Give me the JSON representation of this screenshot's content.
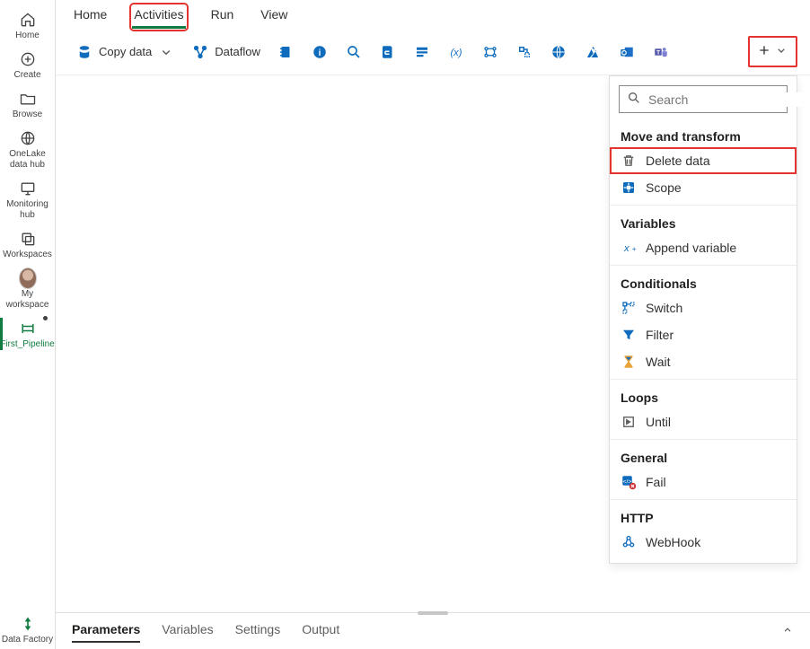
{
  "rail": {
    "items": [
      {
        "label": "Home"
      },
      {
        "label": "Create"
      },
      {
        "label": "Browse"
      },
      {
        "label": "OneLake data hub"
      },
      {
        "label": "Monitoring hub"
      },
      {
        "label": "Workspaces"
      },
      {
        "label": "My workspace"
      },
      {
        "label": "First_Pipeline"
      }
    ],
    "footer": "Data Factory"
  },
  "tabs": [
    "Home",
    "Activities",
    "Run",
    "View"
  ],
  "toolbar": {
    "copy_data": "Copy data",
    "dataflow": "Dataflow"
  },
  "panel": {
    "search_placeholder": "Search",
    "groups": [
      {
        "title": "Move and transform",
        "items": [
          "Delete data",
          "Scope"
        ]
      },
      {
        "title": "Variables",
        "items": [
          "Append variable"
        ]
      },
      {
        "title": "Conditionals",
        "items": [
          "Switch",
          "Filter",
          "Wait"
        ]
      },
      {
        "title": "Loops",
        "items": [
          "Until"
        ]
      },
      {
        "title": "General",
        "items": [
          "Fail"
        ]
      },
      {
        "title": "HTTP",
        "items": [
          "WebHook"
        ]
      }
    ]
  },
  "bottom_tabs": [
    "Parameters",
    "Variables",
    "Settings",
    "Output"
  ]
}
